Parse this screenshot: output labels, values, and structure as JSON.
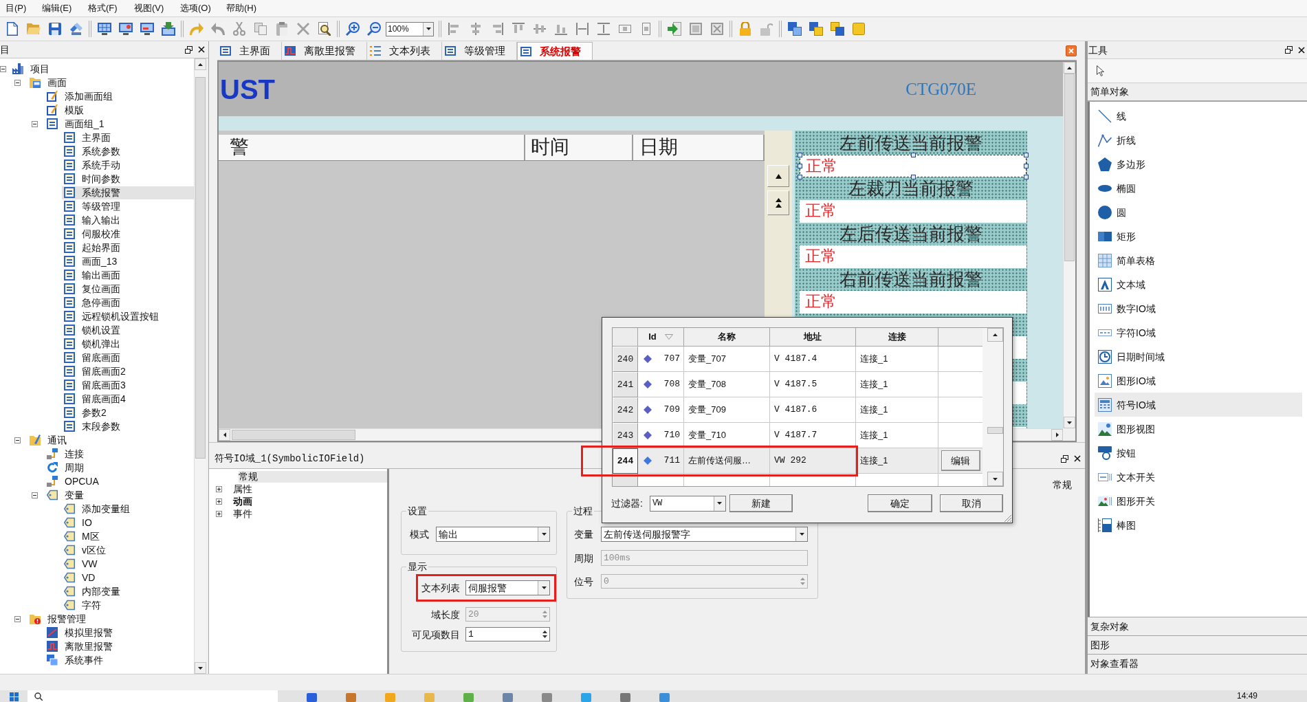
{
  "menu": [
    "目(P)",
    "编辑(E)",
    "格式(F)",
    "视图(V)",
    "选项(O)",
    "帮助(H)"
  ],
  "toolbar": {
    "zoom": "100%"
  },
  "project_panel": {
    "title": "目",
    "tree": [
      {
        "label": "项目",
        "kind": "project",
        "selected": false,
        "expanded": true,
        "children": [
          {
            "label": "画面",
            "kind": "screens",
            "selected": false,
            "expanded": true,
            "children": [
              {
                "label": "添加画面组",
                "kind": "add",
                "selected": false
              },
              {
                "label": "模版",
                "kind": "add",
                "selected": false
              },
              {
                "label": "画面组_1",
                "kind": "group",
                "selected": false,
                "expanded": true,
                "children": [
                  {
                    "label": "主界面",
                    "kind": "page",
                    "selected": false
                  },
                  {
                    "label": "系统参数",
                    "kind": "page",
                    "selected": false
                  },
                  {
                    "label": "系统手动",
                    "kind": "page",
                    "selected": false
                  },
                  {
                    "label": "时间参数",
                    "kind": "page",
                    "selected": false
                  },
                  {
                    "label": "系统报警",
                    "kind": "page",
                    "selected": true
                  },
                  {
                    "label": "等级管理",
                    "kind": "page",
                    "selected": false
                  },
                  {
                    "label": "输入输出",
                    "kind": "page",
                    "selected": false
                  },
                  {
                    "label": "伺服校准",
                    "kind": "page",
                    "selected": false
                  },
                  {
                    "label": "起始界面",
                    "kind": "page",
                    "selected": false
                  },
                  {
                    "label": "画面_13",
                    "kind": "page",
                    "selected": false
                  },
                  {
                    "label": "输出画面",
                    "kind": "page",
                    "selected": false
                  },
                  {
                    "label": "复位画面",
                    "kind": "page",
                    "selected": false
                  },
                  {
                    "label": "急停画面",
                    "kind": "page",
                    "selected": false
                  },
                  {
                    "label": "远程锁机设置按钮",
                    "kind": "page",
                    "selected": false
                  },
                  {
                    "label": "锁机设置",
                    "kind": "page",
                    "selected": false
                  },
                  {
                    "label": "锁机弹出",
                    "kind": "page",
                    "selected": false
                  },
                  {
                    "label": "留底画面",
                    "kind": "page",
                    "selected": false
                  },
                  {
                    "label": "留底画面2",
                    "kind": "page",
                    "selected": false
                  },
                  {
                    "label": "留底画面3",
                    "kind": "page",
                    "selected": false
                  },
                  {
                    "label": "留底画面4",
                    "kind": "page",
                    "selected": false
                  },
                  {
                    "label": "参数2",
                    "kind": "page",
                    "selected": false
                  },
                  {
                    "label": "末段参数",
                    "kind": "page",
                    "selected": false
                  }
                ]
              }
            ]
          },
          {
            "label": "通讯",
            "kind": "comm",
            "selected": false,
            "expanded": true,
            "children": [
              {
                "label": "连接",
                "kind": "connection",
                "selected": false
              },
              {
                "label": "周期",
                "kind": "cycle",
                "selected": false
              },
              {
                "label": "OPCUA",
                "kind": "connection",
                "selected": false
              },
              {
                "label": "变量",
                "kind": "variables",
                "selected": false,
                "expanded": true,
                "children": [
                  {
                    "label": "添加变量组",
                    "kind": "variable",
                    "selected": false
                  },
                  {
                    "label": "IO",
                    "kind": "variable",
                    "selected": false
                  },
                  {
                    "label": "M区",
                    "kind": "variable",
                    "selected": false
                  },
                  {
                    "label": "v区位",
                    "kind": "variable",
                    "selected": false
                  },
                  {
                    "label": "VW",
                    "kind": "variable",
                    "selected": false
                  },
                  {
                    "label": "VD",
                    "kind": "variable",
                    "selected": false
                  },
                  {
                    "label": "内部变量",
                    "kind": "variable",
                    "selected": false
                  },
                  {
                    "label": "字符",
                    "kind": "variable",
                    "selected": false
                  }
                ]
              }
            ]
          },
          {
            "label": "报警管理",
            "kind": "alarms",
            "selected": false,
            "expanded": true,
            "children": [
              {
                "label": "模拟里报警",
                "kind": "analog-alarm",
                "selected": false
              },
              {
                "label": "离散里报警",
                "kind": "discrete-alarm",
                "selected": false
              },
              {
                "label": "系统事件",
                "kind": "event",
                "selected": false
              }
            ]
          }
        ]
      }
    ]
  },
  "document_tabs": [
    {
      "label": "主界面",
      "kind": "screen",
      "selected": false
    },
    {
      "label": "离散里报警",
      "kind": "discrete-alarm",
      "selected": false
    },
    {
      "label": "文本列表",
      "kind": "text-list",
      "selected": false
    },
    {
      "label": "等级管理",
      "kind": "screen",
      "selected": false
    },
    {
      "label": "系统报警",
      "kind": "screen",
      "selected": true
    }
  ],
  "canvas": {
    "logo": "UST",
    "model": "CTG070E",
    "alarm_view": {
      "columns": [
        "警",
        "时间",
        "日期"
      ]
    },
    "status_blocks": [
      {
        "title": "左前传送当前报警",
        "value": "正常",
        "selected": true
      },
      {
        "title": "左裁刀当前报警",
        "value": "正常",
        "selected": false
      },
      {
        "title": "左后传送当前报警",
        "value": "正常",
        "selected": false
      },
      {
        "title": "右前传送当前报警",
        "value": "正常",
        "selected": false
      }
    ]
  },
  "variable_dialog": {
    "columns": [
      {
        "label": "Id",
        "sorted": true
      },
      {
        "label": "名称",
        "sorted": false
      },
      {
        "label": "地址",
        "sorted": false
      },
      {
        "label": "连接",
        "sorted": false
      }
    ],
    "rows": [
      {
        "index": "240",
        "id": "707",
        "name": "变量_707",
        "address": "V 4187.4",
        "connection": "连接_1",
        "selected": false,
        "highlighted": false
      },
      {
        "index": "241",
        "id": "708",
        "name": "变量_708",
        "address": "V 4187.5",
        "connection": "连接_1",
        "selected": false,
        "highlighted": false
      },
      {
        "index": "242",
        "id": "709",
        "name": "变量_709",
        "address": "V 4187.6",
        "connection": "连接_1",
        "selected": false,
        "highlighted": false
      },
      {
        "index": "243",
        "id": "710",
        "name": "变量_710",
        "address": "V 4187.7",
        "connection": "连接_1",
        "selected": false,
        "highlighted": false
      },
      {
        "index": "244",
        "id": "711",
        "name": "左前传送伺服…",
        "address": "VW 292",
        "connection": "连接_1",
        "selected": true,
        "highlighted": true,
        "action": "编辑"
      }
    ],
    "filter": {
      "label": "过滤器:",
      "value": "VW"
    },
    "new_button": "新建",
    "buttons": [
      "确定",
      "取消"
    ]
  },
  "properties": {
    "title": "符号IO域_1(SymbolicIOField)",
    "categories": [
      {
        "label": "常规",
        "kind": "leaf",
        "selected": true,
        "emphasized": false
      },
      {
        "label": "属性",
        "kind": "group",
        "expanded": false,
        "selected": false,
        "emphasized": false
      },
      {
        "label": "动画",
        "kind": "group",
        "expanded": false,
        "selected": false,
        "emphasized": true
      },
      {
        "label": "事件",
        "kind": "group",
        "expanded": false,
        "selected": false,
        "emphasized": false
      }
    ],
    "page_title": "常规",
    "settings": {
      "title": "设置",
      "fields": [
        {
          "label": "模式",
          "kind": "dropdown",
          "value": "输出",
          "disabled": false,
          "highlighted": false
        }
      ]
    },
    "display": {
      "title": "显示",
      "fields": [
        {
          "label": "文本列表",
          "kind": "dropdown",
          "value": "伺服报警",
          "disabled": false,
          "highlighted": true
        },
        {
          "label": "域长度",
          "kind": "spinner",
          "value": "20",
          "disabled": true,
          "highlighted": false
        },
        {
          "label": "可见项数目",
          "kind": "spinner",
          "value": "1",
          "disabled": false,
          "highlighted": false
        }
      ]
    },
    "process": {
      "title": "过程",
      "fields": [
        {
          "label": "变量",
          "kind": "dropdown",
          "value": "左前传送伺服报警字",
          "disabled": false,
          "highlighted": false
        },
        {
          "label": "周期",
          "kind": "text",
          "value": "100ms",
          "disabled": true,
          "highlighted": false
        },
        {
          "label": "位号",
          "kind": "spinner",
          "value": "0",
          "disabled": true,
          "highlighted": false
        }
      ]
    }
  },
  "tools_panel": {
    "title": "工具",
    "section": "简单对象",
    "items": [
      {
        "label": "线",
        "kind": "line",
        "selected": false
      },
      {
        "label": "折线",
        "kind": "polyline",
        "selected": false
      },
      {
        "label": "多边形",
        "kind": "polygon",
        "selected": false
      },
      {
        "label": "椭圆",
        "kind": "ellipse",
        "selected": false
      },
      {
        "label": "圆",
        "kind": "circle",
        "selected": false
      },
      {
        "label": "矩形",
        "kind": "rectangle",
        "selected": false
      },
      {
        "label": "简单表格",
        "kind": "table",
        "selected": false
      },
      {
        "label": "文本域",
        "kind": "text",
        "selected": false
      },
      {
        "label": "数字IO域",
        "kind": "numeric-io",
        "selected": false
      },
      {
        "label": "字符IO域",
        "kind": "char-io",
        "selected": false
      },
      {
        "label": "日期时间域",
        "kind": "datetime",
        "selected": false
      },
      {
        "label": "图形IO域",
        "kind": "graphic-io",
        "selected": false
      },
      {
        "label": "符号IO域",
        "kind": "symbolic-io",
        "selected": true
      },
      {
        "label": "图形视图",
        "kind": "graphic-view",
        "selected": false
      },
      {
        "label": "按钮",
        "kind": "button",
        "selected": false
      },
      {
        "label": "文本开关",
        "kind": "text-switch",
        "selected": false
      },
      {
        "label": "图形开关",
        "kind": "graphic-switch",
        "selected": false
      },
      {
        "label": "棒图",
        "kind": "bar",
        "selected": false
      }
    ],
    "other_sections": [
      "复杂对象",
      "图形",
      "对象查看器"
    ]
  },
  "taskbar": {
    "time": "14:49"
  }
}
